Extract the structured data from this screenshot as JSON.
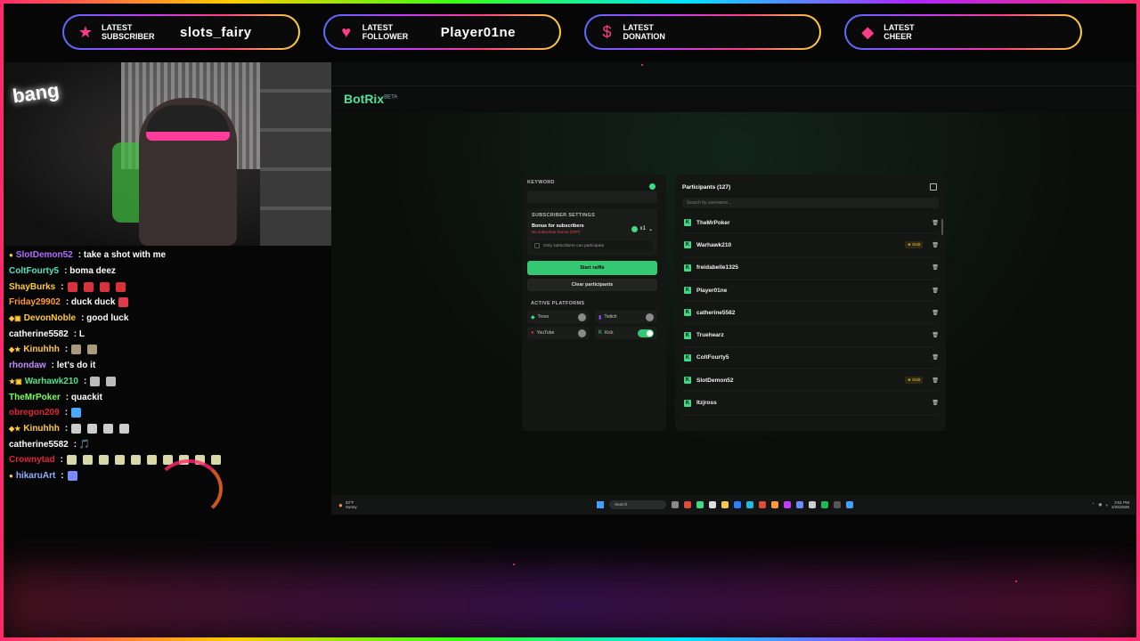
{
  "alerts": [
    {
      "icon": "star-icon",
      "label_line1": "LATEST",
      "label_line2": "SUBSCRIBER",
      "value": "slots_fairy"
    },
    {
      "icon": "heart-icon",
      "label_line1": "LATEST",
      "label_line2": "FOLLOWER",
      "value": "Player01ne"
    },
    {
      "icon": "dollar-icon",
      "label_line1": "LATEST",
      "label_line2": "DONATION",
      "value": ""
    },
    {
      "icon": "diamond-icon",
      "label_line1": "LATEST",
      "label_line2": "CHEER",
      "value": ""
    }
  ],
  "webcam": {
    "neon_sign": "bang"
  },
  "chat": [
    {
      "user": "SlotDemon52",
      "color": "#b26bff",
      "message": ": take a shot with me",
      "badge": "●",
      "emotes": 0
    },
    {
      "user": "ColtFourty5",
      "color": "#4ee3c0",
      "message": ": boma deez",
      "badge": "",
      "emotes": 0
    },
    {
      "user": "ShayBurks",
      "color": "#ffcc33",
      "message": ":",
      "badge": "",
      "emotes": 4,
      "emote_color": "#d8333a"
    },
    {
      "user": "Friday29902",
      "color": "#ff9a3d",
      "message": ": duck duck",
      "badge": "",
      "emotes": 1,
      "emote_color": "#e03a4a"
    },
    {
      "user": "DevonNoble",
      "color": "#ffcc33",
      "message": ": good luck",
      "badge": "◆▣",
      "emotes": 0
    },
    {
      "user": "catherine5582",
      "color": "#ffffff",
      "message": ": L",
      "badge": "",
      "emotes": 0
    },
    {
      "user": "Kinuhhh",
      "color": "#ffcc33",
      "message": ":",
      "badge": "◆★",
      "emotes": 2,
      "emote_color": "#a89a7a"
    },
    {
      "user": "rhondaw",
      "color": "#c38bff",
      "message": ": let's do it",
      "badge": "",
      "emotes": 0
    },
    {
      "user": "Warhawk210",
      "color": "#4ee38a",
      "message": ":",
      "badge": "★▣",
      "emotes": 2,
      "emote_color": "#bbbbbb"
    },
    {
      "user": "TheMrPoker",
      "color": "#7cff5a",
      "message": ": quackit",
      "badge": "",
      "emotes": 0
    },
    {
      "user": "obregon209",
      "color": "#e0223a",
      "message": ":",
      "badge": "",
      "emotes": 1,
      "emote_color": "#4aa8ff"
    },
    {
      "user": "Kinuhhh",
      "color": "#ffcc33",
      "message": ":",
      "badge": "◆★",
      "emotes": 4,
      "emote_color": "#cccccc"
    },
    {
      "user": "catherine5582",
      "color": "#ffffff",
      "message": ": 🎵",
      "badge": "",
      "emotes": 0
    },
    {
      "user": "Crownytad",
      "color": "#e0223a",
      "message": ":",
      "badge": "",
      "emotes": 10,
      "emote_color": "#d8d8a8"
    },
    {
      "user": "hikaruArt",
      "color": "#8fb0ff",
      "message": ":",
      "badge": "●",
      "emotes": 1,
      "emote_color": "#7a8aff"
    }
  ],
  "botrix": {
    "brand": "BotRix",
    "brand_tag": "BETA",
    "keyword_label": "KEYWORD",
    "sub_settings_label": "SUBSCRIBER SETTINGS",
    "bonus_title": "Bonus for subscribers",
    "bonus_sub": "No subscriber bonus (OFF)",
    "bonus_multiplier": "x1",
    "only_subs_label": "Only subscribers can participate",
    "start_button": "Start raffle",
    "clear_button": "Clear participants",
    "platforms_label": "ACTIVE PLATFORMS",
    "platforms": [
      {
        "name": "Trovo",
        "icon": "trovo-icon",
        "icon_color": "#3ddc84",
        "enabled": false
      },
      {
        "name": "Twitch",
        "icon": "twitch-icon",
        "icon_color": "#9146ff",
        "enabled": false
      },
      {
        "name": "YouTube",
        "icon": "youtube-icon",
        "icon_color": "#ff2020",
        "enabled": false
      },
      {
        "name": "Kick",
        "icon": "kick-icon",
        "icon_color": "#3ddc84",
        "enabled": true
      }
    ],
    "participants_title": "Participants (127)",
    "search_placeholder": "Search by username...",
    "participants": [
      {
        "name": "TheMrPoker",
        "sub": false
      },
      {
        "name": "Warhawk210",
        "sub": true
      },
      {
        "name": "freidabelle1325",
        "sub": false
      },
      {
        "name": "Player01ne",
        "sub": false
      },
      {
        "name": "catherine5582",
        "sub": false
      },
      {
        "name": "Truehearz",
        "sub": false
      },
      {
        "name": "ColtFourty5",
        "sub": false
      },
      {
        "name": "SlotDemon52",
        "sub": true
      },
      {
        "name": "Itzjross",
        "sub": false
      }
    ],
    "sub_badge": "★ SUB"
  },
  "taskbar": {
    "weather_temp": "33°F",
    "weather_desc": "Sunny",
    "search": "Search",
    "time": "3:51 PM",
    "date": "2/25/2025"
  },
  "colors": {
    "accent": "#35c873",
    "alert_pink": "#ff3c8a"
  }
}
